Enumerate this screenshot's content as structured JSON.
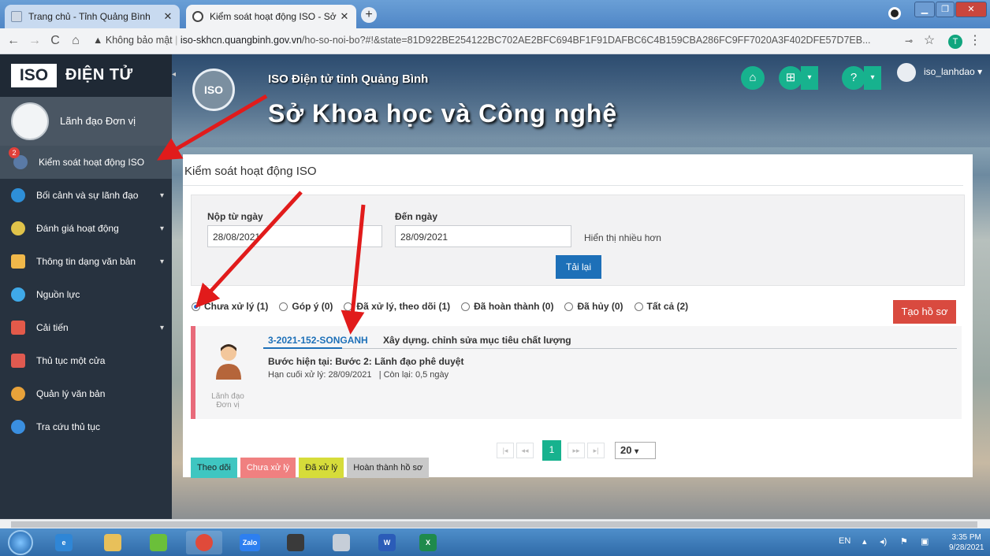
{
  "browser": {
    "tabs": [
      {
        "title": "Trang chủ - Tỉnh Quảng Bình"
      },
      {
        "title": "Kiểm soát hoạt động ISO - Sở Kh"
      }
    ],
    "address": {
      "security_label": "Không bảo mật",
      "host": "iso-skhcn.quangbinh.gov.vn",
      "path": "/ho-so-noi-bo?#!&state=81D922BE254122BC702AE2BFC694BF1F91DAFBC6C4B159CBA286FC9FF7020A3F402DFE57D7EB..."
    },
    "profile_initial": "T"
  },
  "header": {
    "subtitle": "ISO Điện tử tỉnh Quảng Bình",
    "title": "Sở Khoa học và Công nghệ",
    "username": "iso_lanhdao"
  },
  "sidebar": {
    "brand_iso": "ISO",
    "brand_text": "ĐIỆN TỬ",
    "user_name": "Lãnh đạo Đơn vị",
    "items": [
      {
        "label": "Kiểm soát hoạt động ISO",
        "badge": "2",
        "active": true,
        "color": "#5a7aa6"
      },
      {
        "label": "Bối cảnh và sự lãnh đạo",
        "color": "#2e8fd8"
      },
      {
        "label": "Đánh giá hoạt động",
        "color": "#e0c34a"
      },
      {
        "label": "Thông tin dạng văn bản",
        "color": "#f0b84a"
      },
      {
        "label": "Nguồn lực",
        "color": "#3fa9e8"
      },
      {
        "label": "Cải tiến",
        "color": "#e35a4a"
      },
      {
        "label": "Thủ tục một cửa",
        "color": "#e05a50"
      },
      {
        "label": "Quản lý văn bản",
        "color": "#e8a23a"
      },
      {
        "label": "Tra cứu thủ tục",
        "color": "#3a8fe0"
      }
    ]
  },
  "main": {
    "title": "Kiểm soát hoạt động ISO",
    "filter": {
      "from_label": "Nộp từ ngày",
      "from_value": "28/08/2021",
      "to_label": "Đến ngày",
      "to_value": "28/09/2021",
      "more_label": "Hiển thị nhiều hơn",
      "reload_label": "Tải lại"
    },
    "status_tabs": [
      {
        "label": "Chưa xử lý (1)",
        "selected": true
      },
      {
        "label": "Góp ý (0)"
      },
      {
        "label": "Đã xử lý, theo dõi (1)"
      },
      {
        "label": "Đã hoàn thành (0)"
      },
      {
        "label": "Đã hủy (0)"
      },
      {
        "label": "Tất cả (2)"
      }
    ],
    "create_label": "Tạo hồ sơ",
    "record": {
      "code": "3-2021-152-SONGANH",
      "title": "Xây dựng. chỉnh sửa mục tiêu chất lượng",
      "step": "Bước hiện tại: Bước 2: Lãnh đạo phê duyệt",
      "deadline": "Hạn cuối xử lý: 28/09/2021",
      "remaining": "| Còn lại: 0,5 ngày",
      "role_line1": "Lãnh đạo",
      "role_line2": "Đơn vị"
    },
    "pagination": {
      "current": "1",
      "page_size": "20"
    },
    "legend": [
      {
        "label": "Theo dõi",
        "color": "#3fc6c1"
      },
      {
        "label": "Chưa xử lý",
        "color": "#f08080"
      },
      {
        "label": "Đã xử lý",
        "color": "#d6dc3a"
      },
      {
        "label": "Hoàn thành hồ sơ",
        "color": "#c9c9c9"
      }
    ]
  },
  "taskbar": {
    "lang": "EN",
    "time": "3:35 PM",
    "date": "9/28/2021",
    "zalo_label": "Zalo"
  }
}
